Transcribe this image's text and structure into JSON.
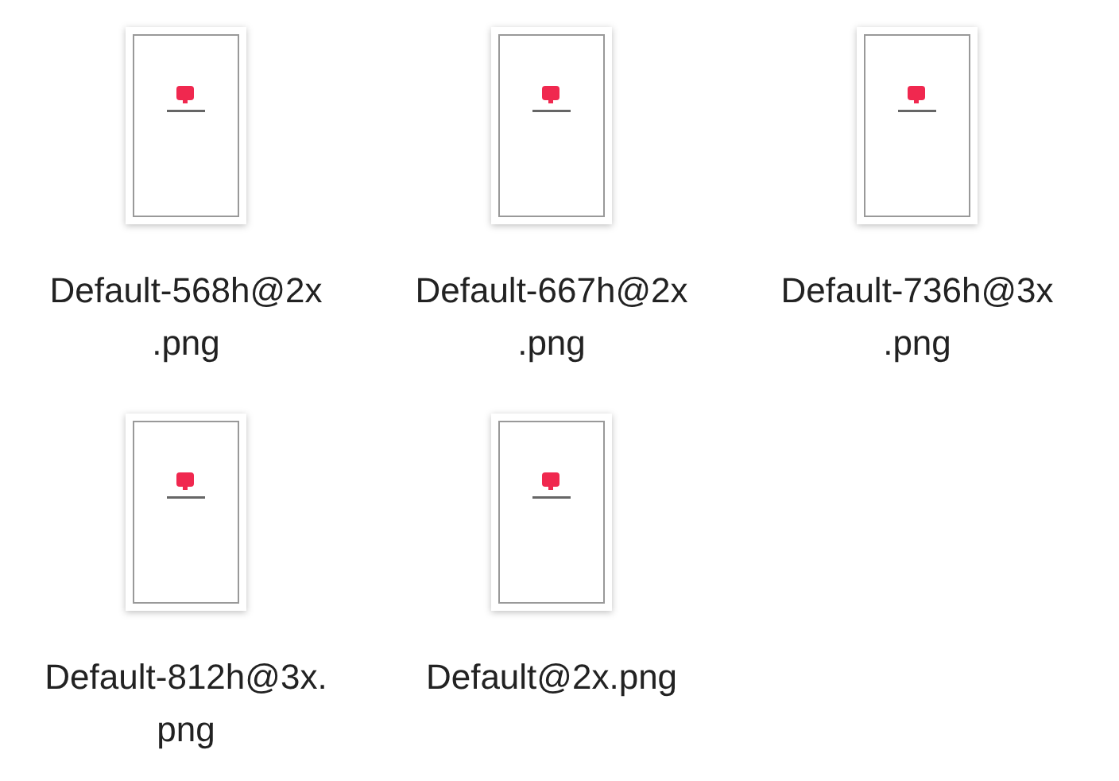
{
  "files": [
    {
      "name": "Default-568h@2x\n.png",
      "selected": false
    },
    {
      "name": "Default-667h@2x\n.png",
      "selected": false
    },
    {
      "name": "Default-736h@3x\n.png",
      "selected": false
    },
    {
      "name": "Default-812h@3x.\npng",
      "selected": false
    },
    {
      "name": "Default@2x.png",
      "selected": false
    }
  ]
}
